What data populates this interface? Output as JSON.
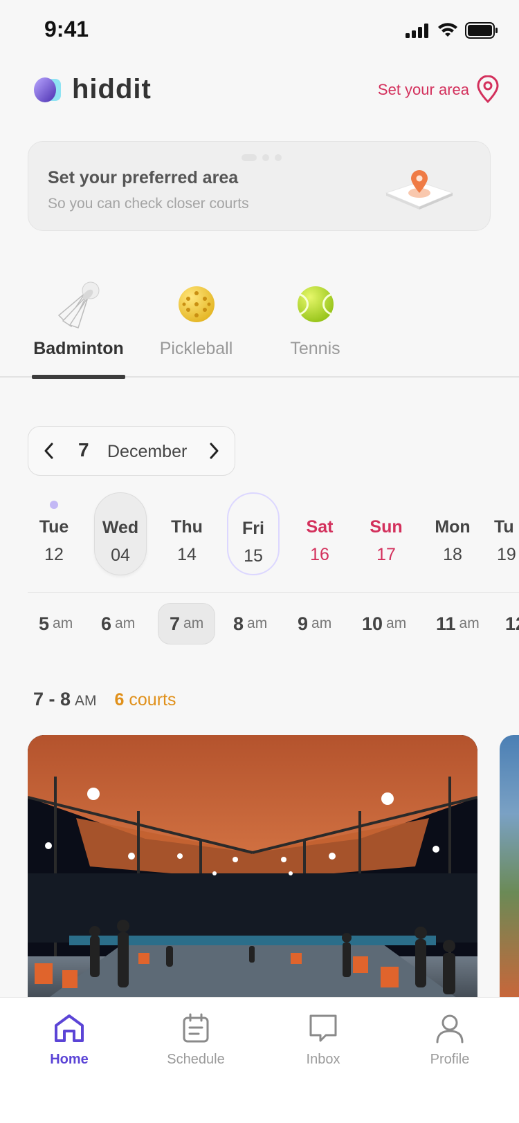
{
  "status_bar": {
    "time": "9:41"
  },
  "header": {
    "logo_text": "hiddit",
    "set_area_label": "Set your area"
  },
  "banner": {
    "title": "Set your preferred area",
    "subtitle": "So you can check closer courts"
  },
  "sports": [
    {
      "label": "Badminton",
      "icon": "shuttlecock-icon",
      "active": true
    },
    {
      "label": "Pickleball",
      "icon": "pickleball-icon",
      "active": false
    },
    {
      "label": "Tennis",
      "icon": "tennis-ball-icon",
      "active": false
    }
  ],
  "month_picker": {
    "day": "7",
    "month": "December"
  },
  "days": [
    {
      "dow": "Tue",
      "num": "12",
      "dot": true
    },
    {
      "dow": "Wed",
      "num": "04",
      "selected": true
    },
    {
      "dow": "Thu",
      "num": "14"
    },
    {
      "dow": "Fri",
      "num": "15",
      "outlined": true
    },
    {
      "dow": "Sat",
      "num": "16",
      "weekend": true
    },
    {
      "dow": "Sun",
      "num": "17",
      "weekend": true
    },
    {
      "dow": "Mon",
      "num": "18"
    },
    {
      "dow": "Tu",
      "num": "19"
    }
  ],
  "hours": [
    {
      "h": "5",
      "ampm": "am"
    },
    {
      "h": "6",
      "ampm": "am"
    },
    {
      "h": "7",
      "ampm": "am",
      "selected": true
    },
    {
      "h": "8",
      "ampm": "am"
    },
    {
      "h": "9",
      "ampm": "am"
    },
    {
      "h": "10",
      "ampm": "am"
    },
    {
      "h": "11",
      "ampm": "am"
    },
    {
      "h": "12",
      "ampm": ""
    }
  ],
  "slot": {
    "range": "7 - 8",
    "ampm": "AM",
    "courts_count": "6",
    "courts_label": "courts"
  },
  "tabbar": {
    "home": "Home",
    "schedule": "Schedule",
    "inbox": "Inbox",
    "profile": "Profile"
  },
  "colors": {
    "accent_pink": "#d3305c",
    "accent_purple": "#5b44d6",
    "courts_orange": "#e0901a"
  }
}
